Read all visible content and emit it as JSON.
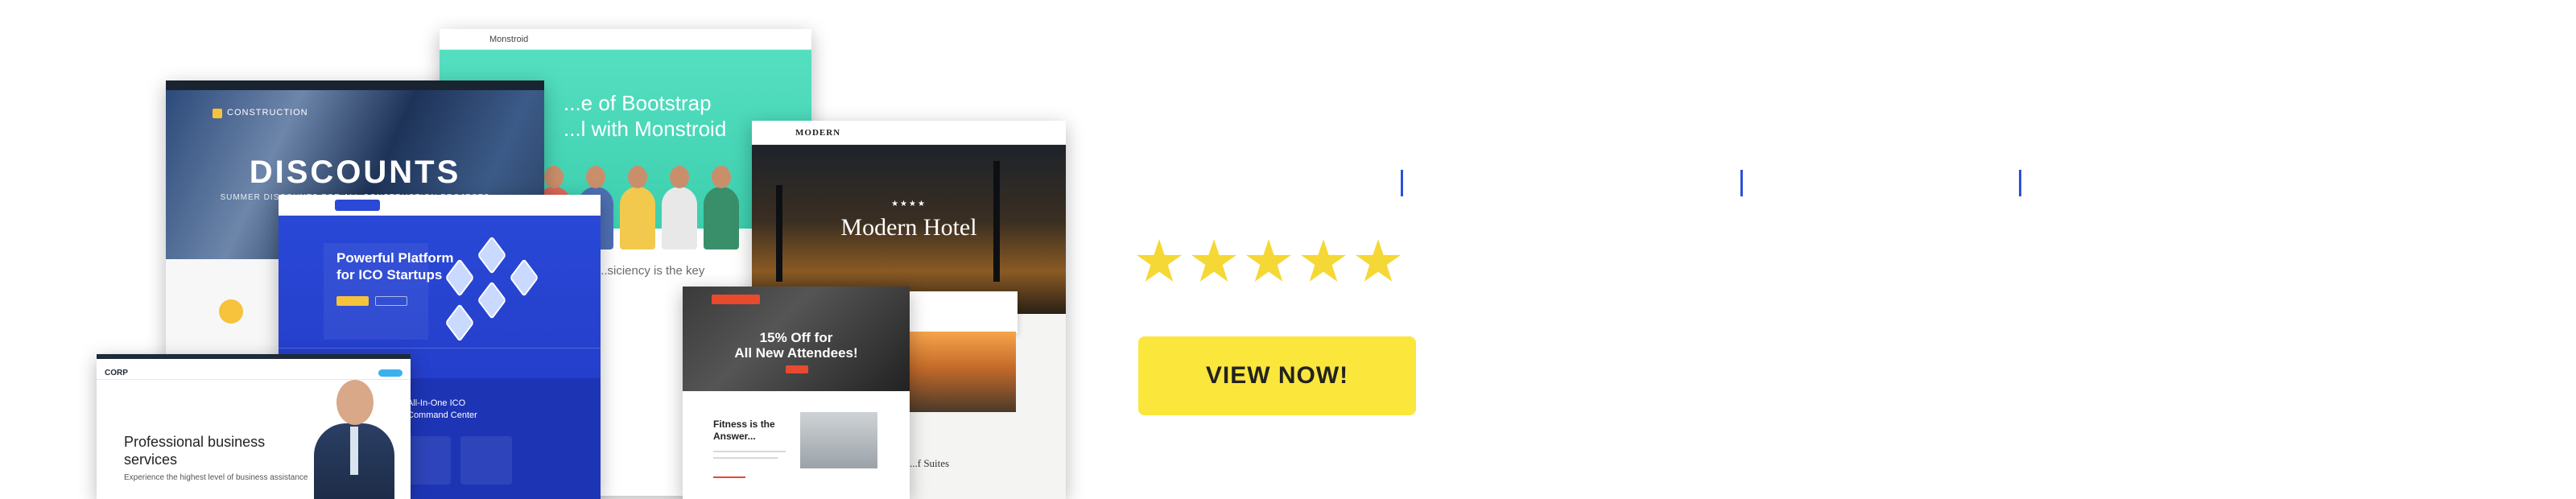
{
  "collage": {
    "monstroid": {
      "hero_line1": "...e of Bootstrap",
      "hero_line2": "...l with Monstroid",
      "logo": "Monstroid",
      "body_text": "...siciency is the key"
    },
    "construction": {
      "brand": "CONSTRUCTION",
      "title": "DISCOUNTS",
      "subtitle": "SUMMER DISCOUNTS FOR ALL CONSTRUCTION PROJECTS"
    },
    "ico": {
      "headline_1": "Powerful Platform",
      "headline_2": "for ICO Startups",
      "section_1": "All-In-One ICO",
      "section_2": "Command Center"
    },
    "hotel": {
      "logo": "MODERN",
      "stars": "★★★★",
      "title": "Modern Hotel",
      "suites": "...f Suites"
    },
    "fitness": {
      "title_1": "15% Off for",
      "title_2": "All New Attendees!",
      "sub_1": "Fitness is the",
      "sub_2": "Answer..."
    },
    "corporate": {
      "logo": "CORP",
      "title_1": "Professional business",
      "title_2": "services",
      "subtitle": "Experience the highest level of business assistance"
    }
  },
  "cta": {
    "rating": 5,
    "rating_max": 5,
    "star_color": "#f5d835",
    "button_label": "VIEW NOW!",
    "button_color": "#fbe63c",
    "accent_color": "#2f4fd6"
  }
}
